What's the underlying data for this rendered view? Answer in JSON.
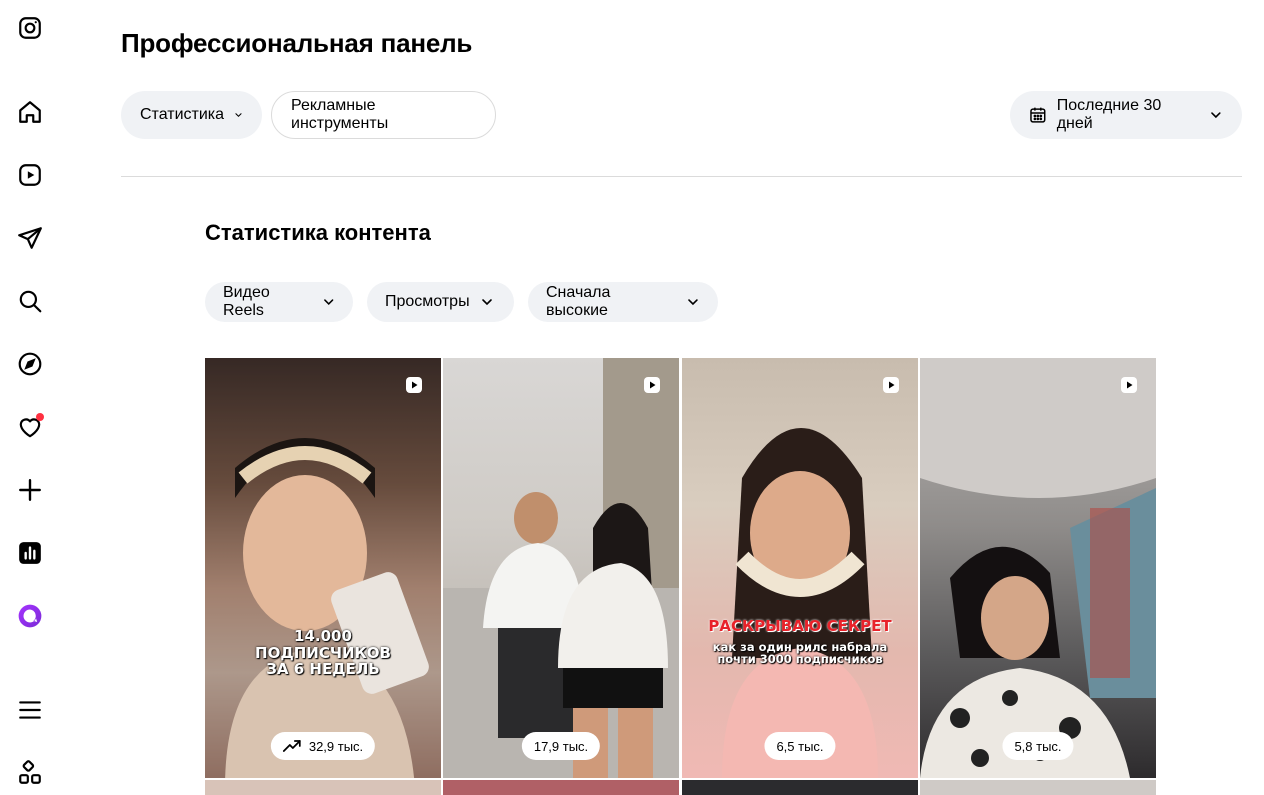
{
  "sidebar": {
    "items": [
      {
        "icon": "instagram-icon"
      },
      {
        "icon": "home-icon"
      },
      {
        "icon": "reels-icon"
      },
      {
        "icon": "direct-messages-icon"
      },
      {
        "icon": "search-icon"
      },
      {
        "icon": "explore-icon"
      },
      {
        "icon": "notifications-heart-icon"
      },
      {
        "icon": "create-plus-icon"
      },
      {
        "icon": "dashboard-icon"
      },
      {
        "icon": "threads-icon"
      },
      {
        "icon": "menu-icon"
      },
      {
        "icon": "more-apps-icon"
      }
    ],
    "notification_dot_color": "#ff3040"
  },
  "header": {
    "title": "Профессиональная панель",
    "tabs": [
      {
        "label": "Статистика"
      },
      {
        "label": "Рекламные инструменты"
      }
    ],
    "date_range": "Последние 30 дней"
  },
  "content": {
    "title": "Статистика контента",
    "filters": [
      {
        "label": "Видео Reels"
      },
      {
        "label": "Просмотры"
      },
      {
        "label": "Сначала высокие"
      }
    ],
    "cards": [
      {
        "stat": "32,9 тыс.",
        "trending": true,
        "overlay": [
          "14.000",
          "ПОДПИСЧИКОВ",
          "ЗА 6 НЕДЕЛЬ"
        ]
      },
      {
        "stat": "17,9 тыс.",
        "trending": false,
        "overlay": []
      },
      {
        "stat": "6,5 тыс.",
        "trending": false,
        "overlay": [
          "РАСКРЫВАЮ СЕКРЕТ",
          "как за один рилс набрала",
          "почти 3000 подписчиков"
        ]
      },
      {
        "stat": "5,8 тыс.",
        "trending": false,
        "overlay": []
      }
    ]
  }
}
